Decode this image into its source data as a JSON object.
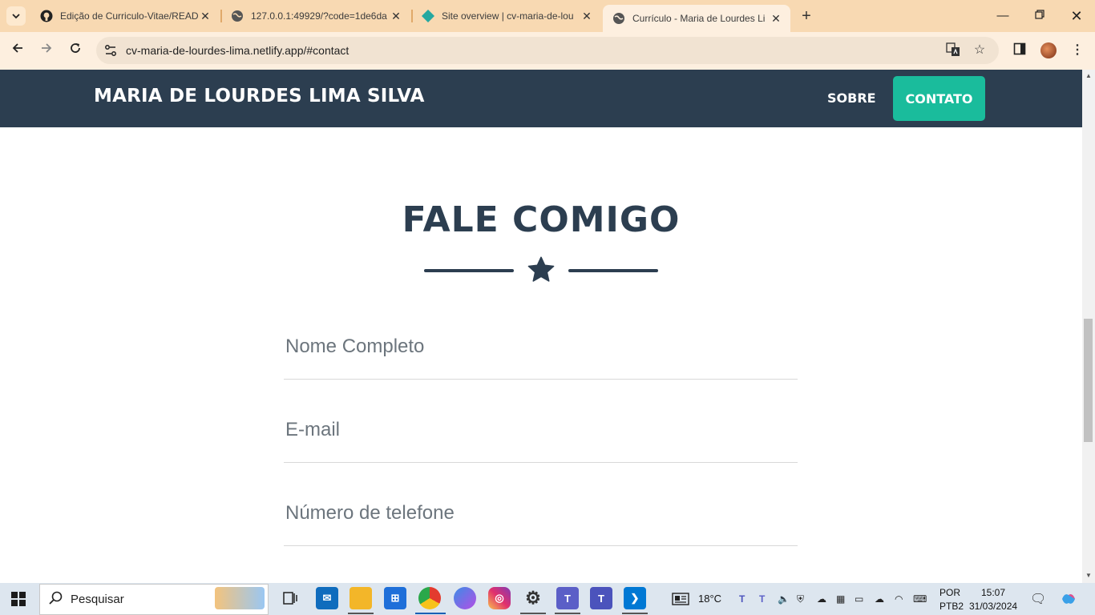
{
  "browser": {
    "tabs": [
      {
        "title": "Edição de Curriculo-Vitae/READ",
        "favicon": "github-icon",
        "active": false
      },
      {
        "title": "127.0.0.1:49929/?code=1de6da",
        "favicon": "globe-icon",
        "active": false
      },
      {
        "title": "Site overview | cv-maria-de-lou",
        "favicon": "netlify-icon",
        "active": false
      },
      {
        "title": "Currículo - Maria de Lourdes Li",
        "favicon": "globe-icon",
        "active": true
      }
    ],
    "url": "cv-maria-de-lourdes-lima.netlify.app/#contact"
  },
  "site": {
    "brand": "MARIA DE LOURDES LIMA SILVA",
    "nav": {
      "sobre": "SOBRE",
      "contato": "CONTATO"
    },
    "colors": {
      "navbar": "#2c3e50",
      "accent": "#1abc9c",
      "heading": "#2c3e50"
    },
    "contact": {
      "title": "FALE COMIGO",
      "divider_icon": "star-icon",
      "fields": [
        {
          "placeholder": "Nome Completo"
        },
        {
          "placeholder": "E-mail"
        },
        {
          "placeholder": "Número de telefone"
        }
      ]
    }
  },
  "taskbar": {
    "search_placeholder": "Pesquisar",
    "weather": "18°C",
    "language": "POR",
    "layout": "PTB2",
    "time": "15:07",
    "date": "31/03/2024"
  }
}
